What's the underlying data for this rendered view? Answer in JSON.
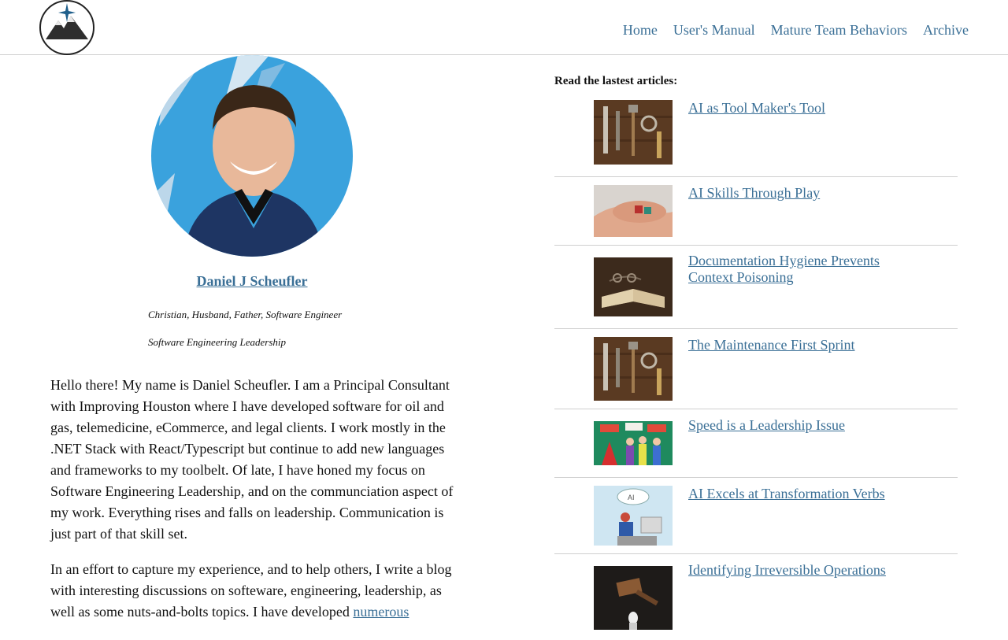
{
  "nav": {
    "items": [
      "Home",
      "User's Manual",
      "Mature Team Behaviors",
      "Archive"
    ]
  },
  "profile": {
    "name": "Daniel J Scheufler",
    "tagline": "Christian, Husband, Father, Software Engineer",
    "focus": "Software Engineering Leadership"
  },
  "bio": {
    "p1": "Hello there! My name is Daniel Scheufler. I am a Principal Consultant with Improving Houston where I have developed software for oil and gas, telemedicine, eCommerce, and legal clients. I work mostly in the .NET Stack with React/Typescript but continue to add new languages and frameworks to my toolbelt. Of late, I have honed my focus on Software Engineering Leadership, and on the communciation aspect of my work. Everything rises and falls on leadership. Communication is just part of that skill set.",
    "p2_start": "In an effort to capture my experience, and to help others, I write a blog with interesting discussions on softeware, engineering, leadership, as well as some nuts-and-bolts topics. I have developed ",
    "p2_link": "numerous"
  },
  "latest": {
    "heading": "Read the lastest articles:",
    "articles": [
      {
        "title": "AI as Tool Maker's Tool",
        "image": "tools-photo"
      },
      {
        "title": "AI Skills Through Play",
        "image": "dice-hand-photo"
      },
      {
        "title": "Documentation Hygiene Prevents Context Poisoning",
        "image": "old-book-photo"
      },
      {
        "title": "The Maintenance First Sprint",
        "image": "tools-photo"
      },
      {
        "title": "Speed is a Leadership Issue",
        "image": "crowd-flags-illustration"
      },
      {
        "title": "AI Excels at Transformation Verbs",
        "image": "ai-robot-illustration"
      },
      {
        "title": "Identifying Irreversible Operations",
        "image": "hammer-egg-photo"
      }
    ]
  },
  "colors": {
    "link": "#3a6f96",
    "divider": "#cfcfcf",
    "avatar_background": "#3aa2dd",
    "shirt": "#1e3563"
  }
}
